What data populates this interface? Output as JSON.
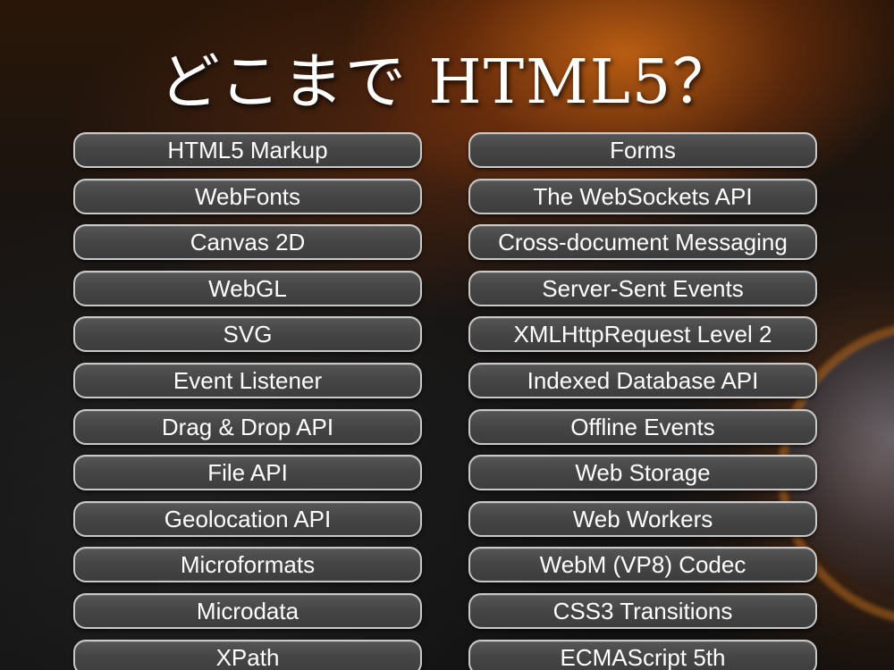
{
  "title": "どこまで HTML5？",
  "left_column": [
    "HTML5 Markup",
    "WebFonts",
    "Canvas 2D",
    "WebGL",
    "SVG",
    "Event Listener",
    "Drag & Drop API",
    "File API",
    "Geolocation API",
    "Microformats",
    "Microdata",
    "XPath"
  ],
  "right_column": [
    "Forms",
    "The WebSockets API",
    "Cross-document Messaging",
    "Server-Sent Events",
    "XMLHttpRequest Level 2",
    "Indexed Database API",
    "Offline Events",
    "Web Storage",
    "Web Workers",
    "WebM (VP8) Codec",
    "CSS3 Transitions",
    "ECMAScript 5th"
  ]
}
